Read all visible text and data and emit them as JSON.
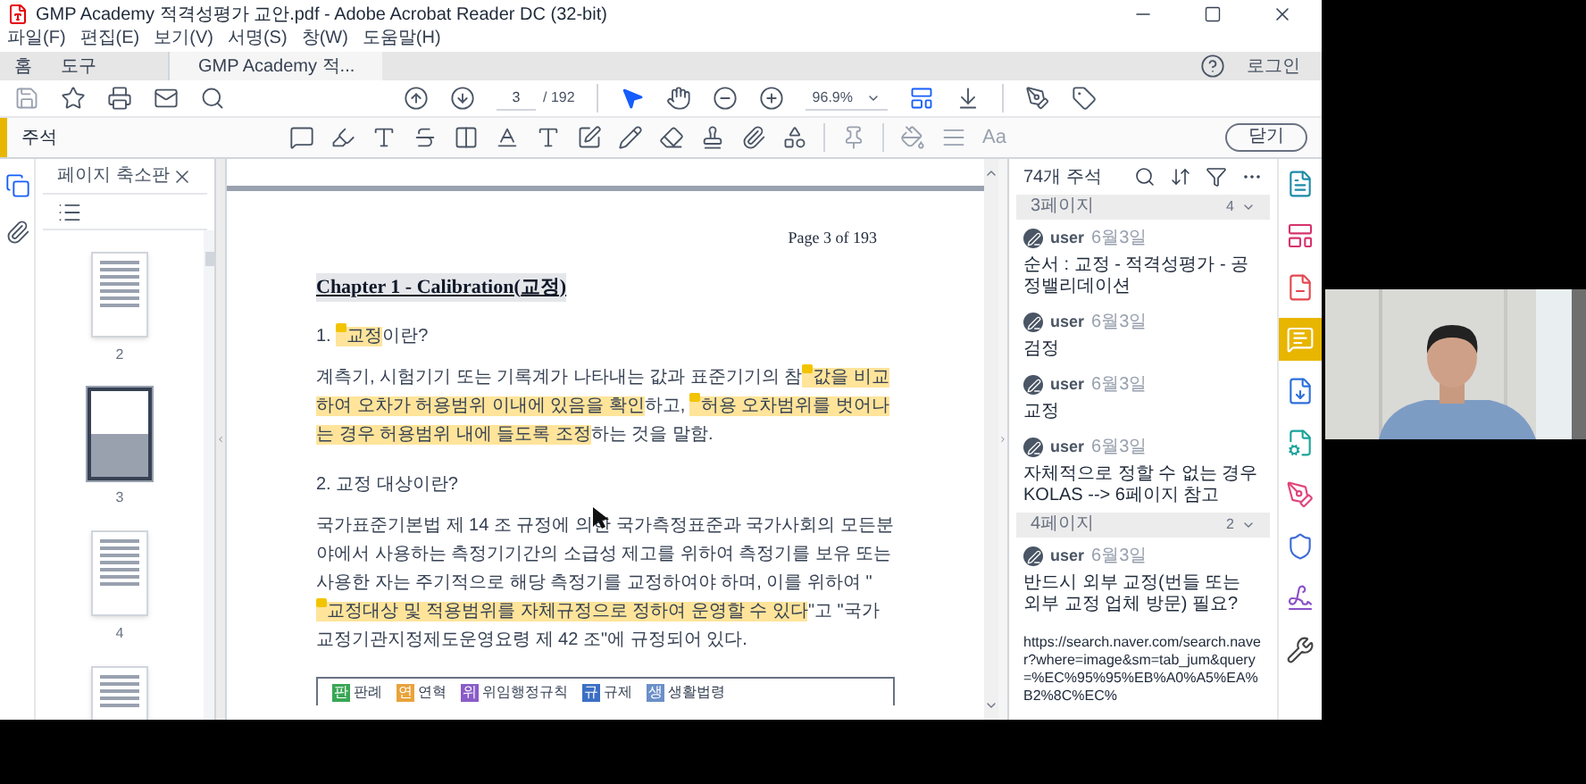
{
  "window": {
    "title": "GMP Academy 적격성평가 교안.pdf - Adobe Acrobat Reader DC (32-bit)"
  },
  "menu": [
    "파일(F)",
    "편집(E)",
    "보기(V)",
    "서명(S)",
    "창(W)",
    "도움말(H)"
  ],
  "tabs": [
    {
      "label": "홈",
      "selected": false
    },
    {
      "label": "도구",
      "selected": false
    },
    {
      "label": "GMP Academy 적...",
      "selected": true
    }
  ],
  "login": "로그인",
  "toolbar": {
    "page": "3",
    "page_count": "/ 192",
    "zoom": "96.9%"
  },
  "comment_toolbar": {
    "title": "주석",
    "font_label": "Aa",
    "close": "닫기"
  },
  "thumbnails": {
    "title": "페이지 축소판",
    "pages": [
      {
        "label": "2",
        "selected": false
      },
      {
        "label": "3",
        "selected": true
      },
      {
        "label": "4",
        "selected": false
      }
    ]
  },
  "document": {
    "page_header": "Page 3 of 193",
    "chapter": "Chapter 1 - Calibration(교정)",
    "sections": [
      {
        "kind": "heading",
        "segments": [
          {
            "text": "1. ",
            "highlight": false,
            "note": false
          },
          {
            "text": "교정",
            "highlight": true,
            "note": true
          },
          {
            "text": "이란?",
            "highlight": false,
            "note": false
          }
        ]
      },
      {
        "kind": "paragraph",
        "segments": [
          {
            "text": "계측기, 시험기기 또는 기록계가 나타내는 값과 표준기기의 참",
            "highlight": false,
            "note": false
          },
          {
            "text": "값을 비교하여 오차가 허용범위 이내에 있음을 확인",
            "highlight": true,
            "note": true
          },
          {
            "text": "하고, ",
            "highlight": false,
            "note": false
          },
          {
            "text": "허용 오차범위를 벗어나는 경우 허용범위 내에 들도록 조정",
            "highlight": true,
            "note": true
          },
          {
            "text": "하는 것을 말함.",
            "highlight": false,
            "note": false
          }
        ]
      },
      {
        "kind": "heading",
        "segments": [
          {
            "text": "2. 교정 대상이란?",
            "highlight": false,
            "note": false
          }
        ]
      },
      {
        "kind": "paragraph",
        "segments": [
          {
            "text": "국가표준기본법 제 14 조 규정에 의한 국가측정표준과 국가사회의 모든분야에서 사용하는 측정기기간의 소급성 제고를 위하여 측정기를 보유 또는 사용한 자는 주기적으로 해당 측정기를 교정하여야 하며, 이를 위하여 \"",
            "highlight": false,
            "note": false
          },
          {
            "text": "교정대상 및 적용범위를 자체규정으로 정하여 운영할 수 있다",
            "highlight": true,
            "note": true
          },
          {
            "text": "\"고 \"국가교정기관지정제도운영요령 제 42 조\"에 규정되어 있다.",
            "highlight": false,
            "note": false
          }
        ]
      }
    ],
    "legend": [
      {
        "badge": "판",
        "label": "판례",
        "color": "#3aa655"
      },
      {
        "badge": "연",
        "label": "연혁",
        "color": "#e8a33c"
      },
      {
        "badge": "위",
        "label": "위임행정규칙",
        "color": "#8a5cc7"
      },
      {
        "badge": "규",
        "label": "규제",
        "color": "#3b6fc4"
      },
      {
        "badge": "생",
        "label": "생활법령",
        "color": "#6b8fc9"
      }
    ]
  },
  "comments": {
    "title": "74개 주석",
    "groups": [
      {
        "page": "3페이지",
        "count": "4",
        "comments": [
          {
            "author": "user",
            "date": "6월3일",
            "text": "순서 : 교정 - 적격성평가 - 공정밸리데이션"
          },
          {
            "author": "user",
            "date": "6월3일",
            "text": "검정"
          },
          {
            "author": "user",
            "date": "6월3일",
            "text": "교정"
          },
          {
            "author": "user",
            "date": "6월3일",
            "text": "자체적으로 정할 수 없는 경우\nKOLAS --> 6페이지 참고"
          }
        ]
      },
      {
        "page": "4페이지",
        "count": "2",
        "comments": [
          {
            "author": "user",
            "date": "6월3일",
            "text": "반드시 외부 교정(번들 또는 외부 교정 업체 방문) 필요?",
            "link": "https://search.naver.com/search.naver?where=image&sm=tab_jum&query=%EC%95%95%EB%A0%A5%EA%B2%8C%EC%"
          }
        ]
      }
    ]
  },
  "tools": [
    {
      "color": "#1d8aa8",
      "selected": false
    },
    {
      "color": "#d6336c",
      "selected": false
    },
    {
      "color": "#e34850",
      "selected": false
    },
    {
      "color": "#ffffff",
      "selected": true
    },
    {
      "color": "#2d6fd9",
      "selected": false
    },
    {
      "color": "#1aa39a",
      "selected": false
    },
    {
      "color": "#e0457b",
      "selected": false
    },
    {
      "color": "#3d6bd6",
      "selected": false
    },
    {
      "color": "#8b4fc9",
      "selected": false
    },
    {
      "color": "#444444",
      "selected": false
    }
  ]
}
